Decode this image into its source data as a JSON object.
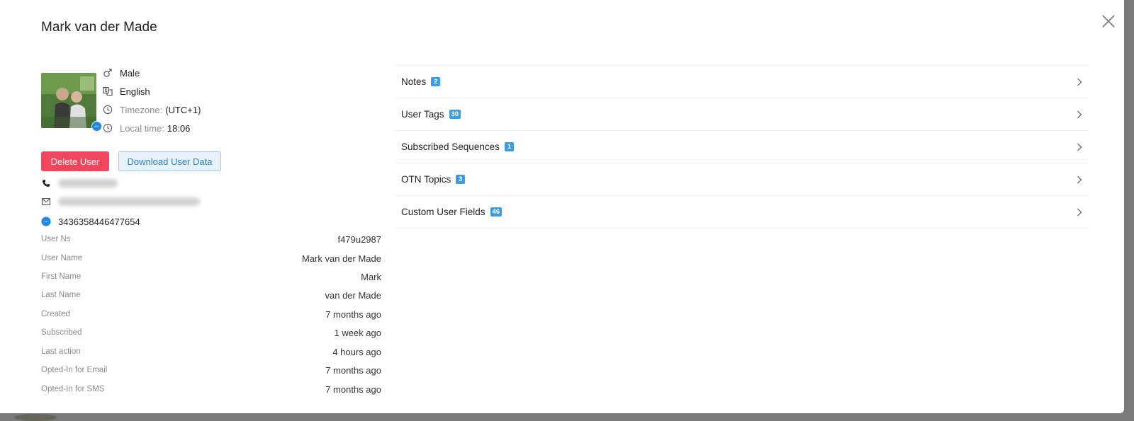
{
  "modal": {
    "title": "Mark van der Made"
  },
  "profile": {
    "gender": "Male",
    "language": "English",
    "timezone_label": "Timezone:",
    "timezone_value": "(UTC+1)",
    "localtime_label": "Local time:",
    "localtime_value": "18:06"
  },
  "actions": {
    "delete_label": "Delete User",
    "download_label": "Download User Data"
  },
  "contacts": {
    "messenger_id": "3436358446477654"
  },
  "details": [
    {
      "key": "User Ns",
      "value": "f479u2987"
    },
    {
      "key": "User Name",
      "value": "Mark van der Made"
    },
    {
      "key": "First Name",
      "value": "Mark"
    },
    {
      "key": "Last Name",
      "value": "van der Made"
    },
    {
      "key": "Created",
      "value": "7 months ago"
    },
    {
      "key": "Subscribed",
      "value": "1 week ago"
    },
    {
      "key": "Last action",
      "value": "4 hours ago"
    },
    {
      "key": "Opted-In for Email",
      "value": "7 months ago"
    },
    {
      "key": "Opted-In for SMS",
      "value": "7 months ago"
    }
  ],
  "sections": [
    {
      "label": "Notes",
      "count": "2"
    },
    {
      "label": "User Tags",
      "count": "30"
    },
    {
      "label": "Subscribed Sequences",
      "count": "1"
    },
    {
      "label": "OTN Topics",
      "count": "3"
    },
    {
      "label": "Custom User Fields",
      "count": "46"
    }
  ],
  "colors": {
    "delete": "#f0465c",
    "download_text": "#2a80c8",
    "badge": "#3d9be0",
    "messenger": "#1e88e5"
  },
  "icons": {
    "close": "close-icon",
    "gender": "male-icon",
    "language": "translate-icon",
    "timezone": "clock-icon",
    "localtime": "clock-icon",
    "phone": "phone-icon",
    "email": "mail-icon",
    "messenger": "messenger-icon",
    "chevron": "chevron-right-icon"
  }
}
